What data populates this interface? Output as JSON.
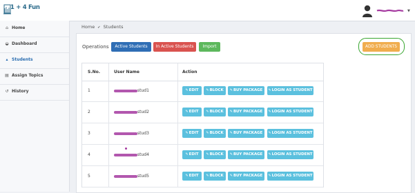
{
  "app": {
    "logo_text": "1 + 4 Fun"
  },
  "sidebar": {
    "items": [
      {
        "label": "Home",
        "icon": "home-icon"
      },
      {
        "label": "Dashboard",
        "icon": "dashboard-icon"
      },
      {
        "label": "Students",
        "icon": "graduation-cap-icon",
        "active": true
      },
      {
        "label": "Assign Topics",
        "icon": "file-icon"
      },
      {
        "label": "History",
        "icon": "history-icon"
      }
    ]
  },
  "breadcrumb": {
    "home": "Home",
    "current": "Students"
  },
  "operations": {
    "label": "Operations",
    "active_students": "Active Students",
    "inactive_students": "In Active Students",
    "import": "Import",
    "add_students": "ADD STUDENTS"
  },
  "table": {
    "headers": {
      "sno": "S.No.",
      "user": "User Name",
      "action": "Action"
    },
    "actions": {
      "edit": "EDIT",
      "block": "BLOCK",
      "buy": "BUY PACKAGE",
      "login": "LOGIN AS STUDENT"
    },
    "rows": [
      {
        "sno": "1",
        "username": "stud1"
      },
      {
        "sno": "2",
        "username": "stud2"
      },
      {
        "sno": "3",
        "username": "stud3"
      },
      {
        "sno": "4",
        "username": "stud4"
      },
      {
        "sno": "5",
        "username": "stud5"
      }
    ]
  },
  "colors": {
    "primary": "#2f6eb5",
    "danger": "#d9534f",
    "success": "#5cb85c",
    "warning": "#f0ad4e",
    "info": "#5bc0de",
    "highlight": "#37a52e"
  }
}
